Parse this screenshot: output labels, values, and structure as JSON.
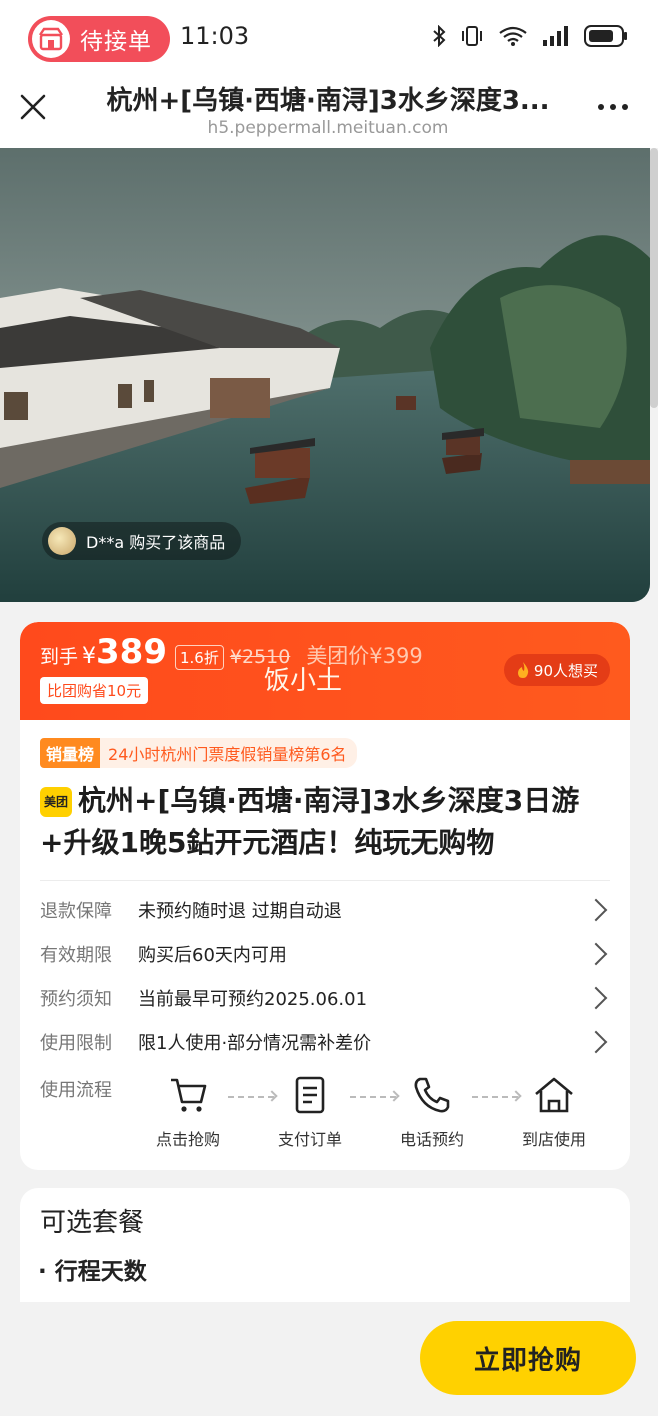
{
  "status_bar": {
    "pill_label": "待接单",
    "time": "11:03",
    "icons": [
      "bluetooth-icon",
      "vibrate-icon",
      "wifi-icon",
      "signal-icon",
      "battery-icon"
    ]
  },
  "header": {
    "title": "杭州+[乌镇·西塘·南浔]3水乡深度3...",
    "url": "h5.peppermall.meituan.com"
  },
  "hero": {
    "buyer_notice": "D**a 购买了该商品"
  },
  "price": {
    "label": "到手",
    "currency": "¥",
    "value": "389",
    "discount": "1.6折",
    "original": "¥2510",
    "meituan_price": "美团价¥399",
    "save_tag": "比团购省10元",
    "watermark": "饭小土",
    "want_count": "90人想买"
  },
  "product": {
    "rank_tag": "销量榜",
    "rank_text": "24小时杭州门票度假销量榜第6名",
    "brand_logo": "美团",
    "title": "杭州+[乌镇·西塘·南浔]3水乡深度3日游+升级1晚5鉆开元酒店！纯玩无购物"
  },
  "info_rows": [
    {
      "label": "退款保障",
      "value": "未预约随时退 过期自动退"
    },
    {
      "label": "有效期限",
      "value": "购买后60天内可用"
    },
    {
      "label": "预约须知",
      "value": "当前最早可预约2025.06.01"
    },
    {
      "label": "使用限制",
      "value": "限1人使用·部分情况需补差价"
    }
  ],
  "flow": {
    "label": "使用流程",
    "steps": [
      {
        "label": "点击抢购",
        "icon": "cart-icon"
      },
      {
        "label": "支付订单",
        "icon": "document-icon"
      },
      {
        "label": "电话预约",
        "icon": "phone-icon"
      },
      {
        "label": "到店使用",
        "icon": "home-icon"
      }
    ]
  },
  "options": {
    "title": "可选套餐",
    "subtitle": "· 行程天数"
  },
  "cta": {
    "buy_label": "立即抢购"
  },
  "colors": {
    "price_band": "#ff4a1c",
    "cta": "#ffd100",
    "pill": "#f24e5a"
  }
}
